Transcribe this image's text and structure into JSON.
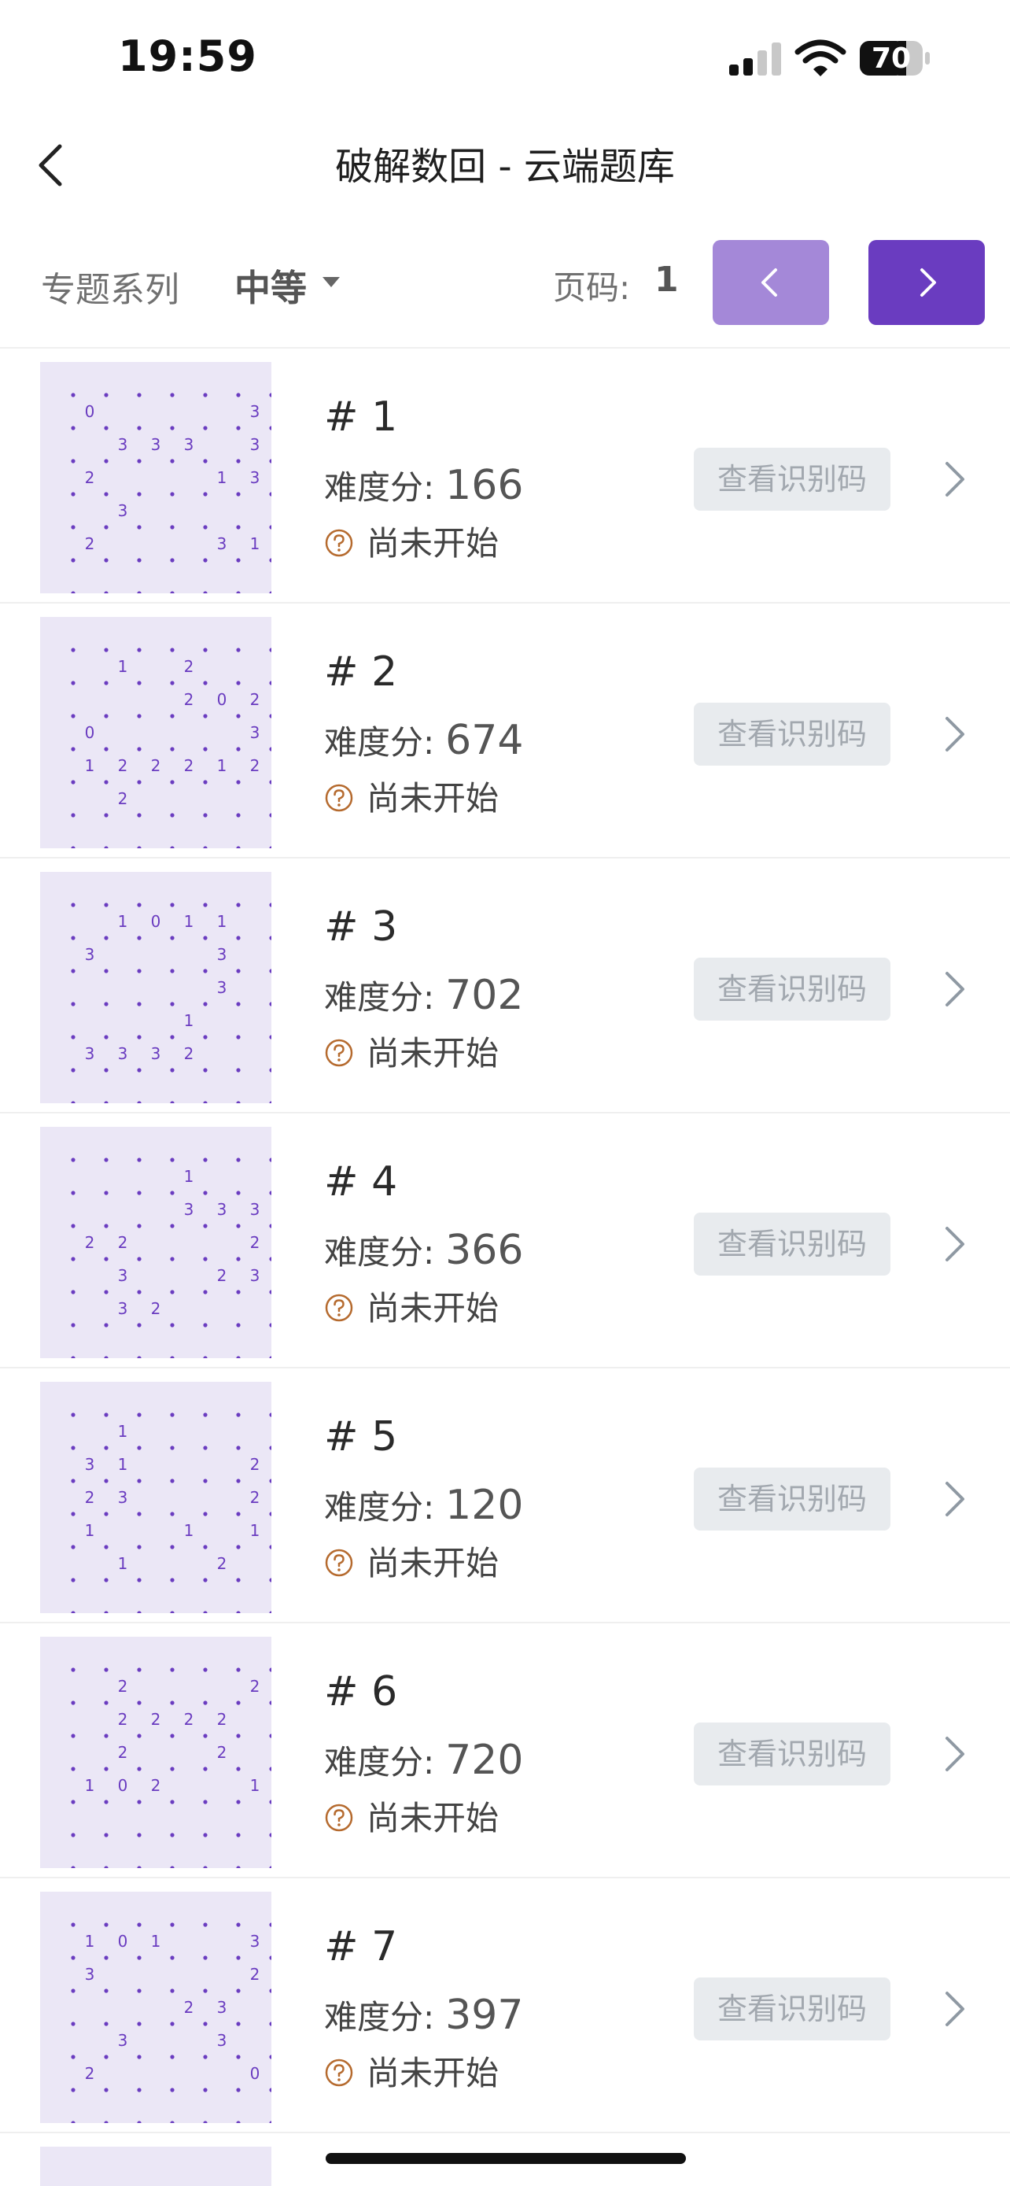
{
  "status_bar": {
    "time": "19:59",
    "battery": "70"
  },
  "nav": {
    "title": "破解数回 - 云端题库"
  },
  "filters": {
    "series_label": "专题系列",
    "difficulty": "中等",
    "page_label": "页码:",
    "page_number": "1"
  },
  "colors": {
    "accent": "#6a3cc0",
    "accent_light": "#a488d8",
    "thumb_bg": "#ebe7f6",
    "status_icon": "#b56a2e"
  },
  "puzzles": [
    {
      "id": "# 1",
      "score_label": "难度分:",
      "score": "166",
      "status": "尚未开始",
      "code_label": "查看识别码",
      "grid": [
        "0....3",
        ".333.3",
        "2...13",
        ".3....",
        "2...31",
        "......"
      ]
    },
    {
      "id": "# 2",
      "score_label": "难度分:",
      "score": "674",
      "status": "尚未开始",
      "code_label": "查看识别码",
      "grid": [
        ".1.2..",
        "...202",
        "0....3",
        "122212",
        ".2....",
        "......"
      ]
    },
    {
      "id": "# 3",
      "score_label": "难度分:",
      "score": "702",
      "status": "尚未开始",
      "code_label": "查看识别码",
      "grid": [
        ".1011.",
        "3...3.",
        "....3.",
        "...1..",
        "3332..",
        "......"
      ]
    },
    {
      "id": "# 4",
      "score_label": "难度分:",
      "score": "366",
      "status": "尚未开始",
      "code_label": "查看识别码",
      "grid": [
        "...1..",
        "...333",
        "22...2",
        ".3..23",
        ".32...",
        "......"
      ]
    },
    {
      "id": "# 5",
      "score_label": "难度分:",
      "score": "120",
      "status": "尚未开始",
      "code_label": "查看识别码",
      "grid": [
        ".1....",
        "31...2",
        "23...2",
        "1..1.1",
        ".1..2.",
        "......"
      ]
    },
    {
      "id": "# 6",
      "score_label": "难度分:",
      "score": "720",
      "status": "尚未开始",
      "code_label": "查看识别码",
      "grid": [
        ".2...2",
        ".2222.",
        ".2..2.",
        "102..1",
        "......",
        "......"
      ]
    },
    {
      "id": "# 7",
      "score_label": "难度分:",
      "score": "397",
      "status": "尚未开始",
      "code_label": "查看识别码",
      "grid": [
        "101..3",
        "3....2",
        "...23.",
        ".3..3.",
        "2....0",
        "......"
      ]
    }
  ]
}
